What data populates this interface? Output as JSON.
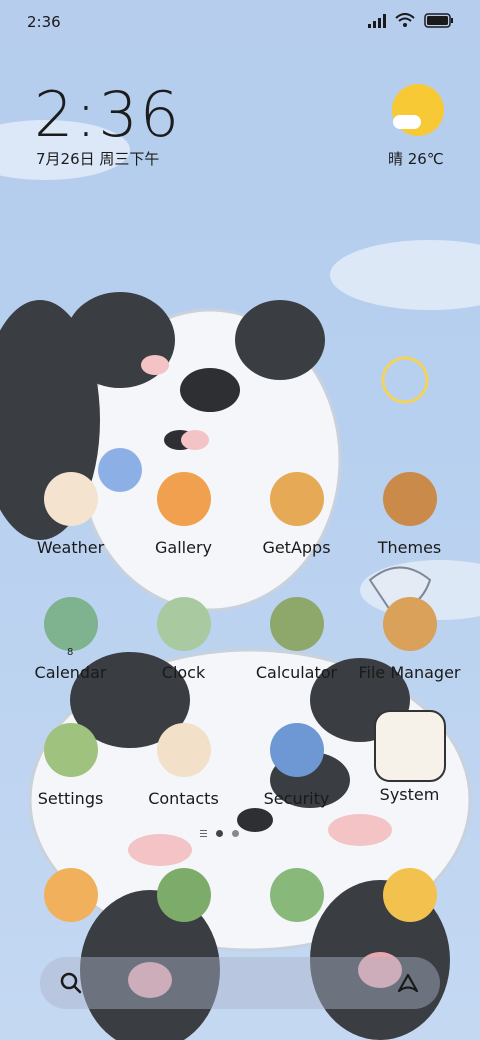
{
  "status_bar": {
    "time": "2:36",
    "icons": [
      "signal-icon",
      "wifi-icon",
      "battery-icon"
    ]
  },
  "clock_widget": {
    "time": "2:36",
    "date": "7月26日 周三下午"
  },
  "weather_widget": {
    "condition_temp": "晴 26℃",
    "icon": "sunny-icon"
  },
  "apps": [
    {
      "name": "weather",
      "label": "Weather",
      "color": "#f3e3cf"
    },
    {
      "name": "gallery",
      "label": "Gallery",
      "color": "#f0a04e"
    },
    {
      "name": "getapps",
      "label": "GetApps",
      "color": "#e6a955"
    },
    {
      "name": "themes",
      "label": "Themes",
      "color": "#c98a4a"
    },
    {
      "name": "calendar",
      "label": "Calendar",
      "color": "#7fb28f",
      "badge": "8"
    },
    {
      "name": "clock",
      "label": "Clock",
      "color": "#a9c9a0"
    },
    {
      "name": "calculator",
      "label": "Calculator",
      "color": "#8ea86b"
    },
    {
      "name": "file-manager",
      "label": "File Manager",
      "color": "#d9a15a"
    },
    {
      "name": "settings",
      "label": "Settings",
      "color": "#9fc27e"
    },
    {
      "name": "contacts",
      "label": "Contacts",
      "color": "#f3e0c8"
    },
    {
      "name": "security",
      "label": "Security",
      "color": "#6d98d3"
    },
    {
      "name": "system",
      "label": "System",
      "color": "#f6f2ea"
    }
  ],
  "dock": [
    {
      "name": "phone",
      "color": "#f1b05c"
    },
    {
      "name": "messages",
      "color": "#7dab6a"
    },
    {
      "name": "browser",
      "color": "#88b97a"
    },
    {
      "name": "camera",
      "color": "#f2c14e"
    }
  ],
  "page_indicator": {
    "pages": 2,
    "current": 1
  },
  "search_bar": {
    "icon": "search-icon",
    "assistant_icon": "assistant-icon"
  }
}
